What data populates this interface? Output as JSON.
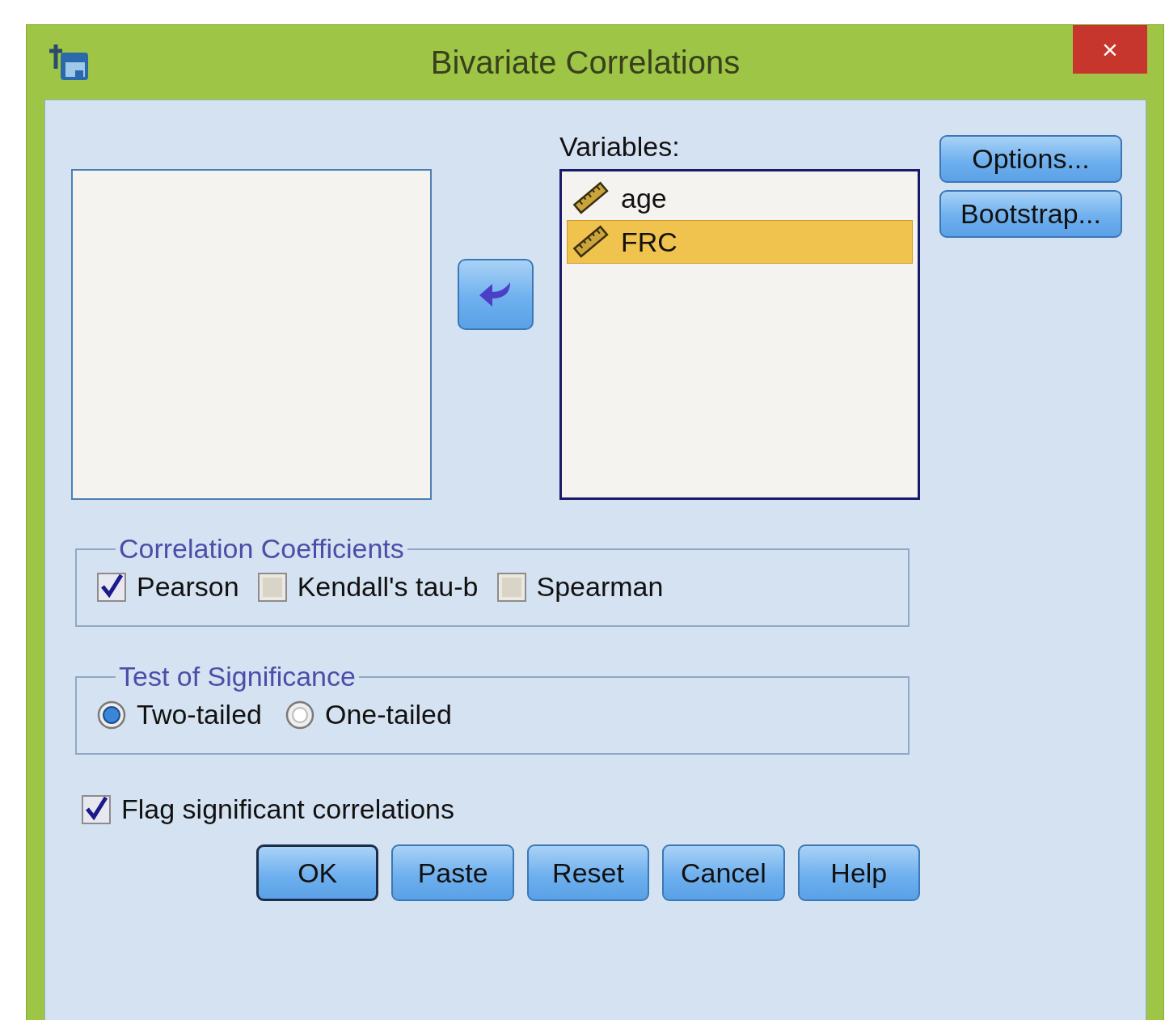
{
  "window": {
    "title": "Bivariate Correlations",
    "close": "×"
  },
  "variables": {
    "label": "Variables:",
    "items": [
      {
        "name": "age",
        "selected": false
      },
      {
        "name": "FRC",
        "selected": true
      }
    ]
  },
  "side_buttons": [
    "Options...",
    "Bootstrap..."
  ],
  "coefficients": {
    "title": "Correlation Coefficients",
    "options": [
      {
        "label": "Pearson",
        "checked": true
      },
      {
        "label": "Kendall's tau-b",
        "checked": false
      },
      {
        "label": "Spearman",
        "checked": false
      }
    ]
  },
  "significance": {
    "title": "Test of Significance",
    "options": [
      {
        "label": "Two-tailed",
        "selected": true
      },
      {
        "label": "One-tailed",
        "selected": false
      }
    ]
  },
  "flag": {
    "label": "Flag significant correlations",
    "checked": true
  },
  "buttons": [
    {
      "label": "OK",
      "default": true
    },
    {
      "label": "Paste",
      "default": false
    },
    {
      "label": "Reset",
      "default": false
    },
    {
      "label": "Cancel",
      "default": false
    },
    {
      "label": "Help",
      "default": false
    }
  ]
}
